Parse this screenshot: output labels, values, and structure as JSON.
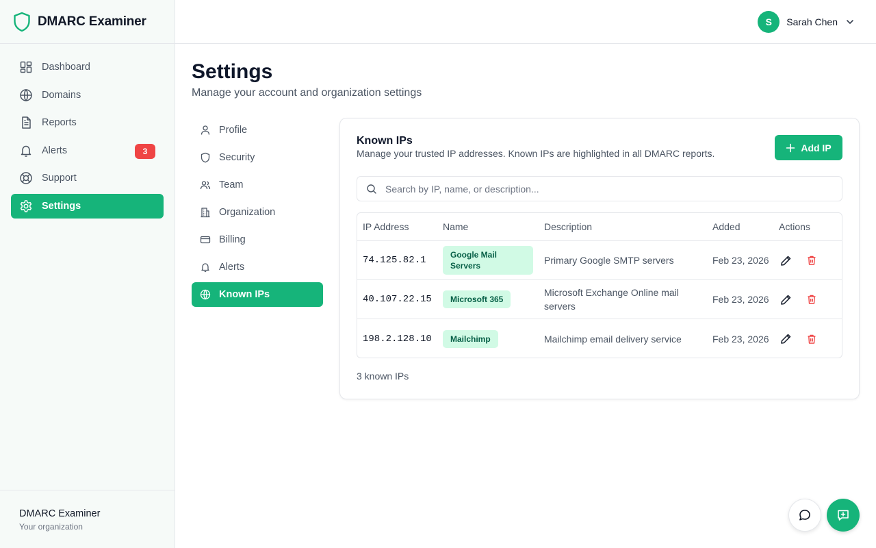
{
  "app": {
    "name": "DMARC Examiner",
    "accent": "#16b47a",
    "danger": "#ef4444"
  },
  "sidebar": {
    "items": [
      {
        "label": "Dashboard",
        "icon": "dashboard-icon"
      },
      {
        "label": "Domains",
        "icon": "globe-icon"
      },
      {
        "label": "Reports",
        "icon": "document-icon"
      },
      {
        "label": "Alerts",
        "icon": "bell-icon",
        "badge": "3"
      },
      {
        "label": "Support",
        "icon": "lifebuoy-icon"
      },
      {
        "label": "Settings",
        "icon": "gear-icon",
        "active": true
      }
    ],
    "org": {
      "name": "DMARC Examiner",
      "subtitle": "Your organization"
    }
  },
  "header": {
    "user": {
      "initial": "S",
      "name": "Sarah Chen"
    }
  },
  "page": {
    "title": "Settings",
    "subtitle": "Manage your account and organization settings"
  },
  "settings_nav": [
    {
      "label": "Profile",
      "icon": "user-icon"
    },
    {
      "label": "Security",
      "icon": "shield-icon"
    },
    {
      "label": "Team",
      "icon": "users-icon"
    },
    {
      "label": "Organization",
      "icon": "building-icon"
    },
    {
      "label": "Billing",
      "icon": "credit-card-icon"
    },
    {
      "label": "Alerts",
      "icon": "bell-icon"
    },
    {
      "label": "Known IPs",
      "icon": "globe-icon",
      "active": true
    }
  ],
  "known_ips": {
    "title": "Known IPs",
    "description": "Manage your trusted IP addresses. Known IPs are highlighted in all DMARC reports.",
    "add_label": "Add IP",
    "search_placeholder": "Search by IP, name, or description...",
    "columns": [
      "IP Address",
      "Name",
      "Description",
      "Added",
      "Actions"
    ],
    "rows": [
      {
        "ip": "74.125.82.1",
        "name": "Google Mail Servers",
        "description": "Primary Google SMTP servers",
        "added": "Feb 23, 2026"
      },
      {
        "ip": "40.107.22.15",
        "name": "Microsoft 365",
        "description": "Microsoft Exchange Online mail servers",
        "added": "Feb 23, 2026"
      },
      {
        "ip": "198.2.128.10",
        "name": "Mailchimp",
        "description": "Mailchimp email delivery service",
        "added": "Feb 23, 2026"
      }
    ],
    "count_text": "3 known IPs"
  }
}
